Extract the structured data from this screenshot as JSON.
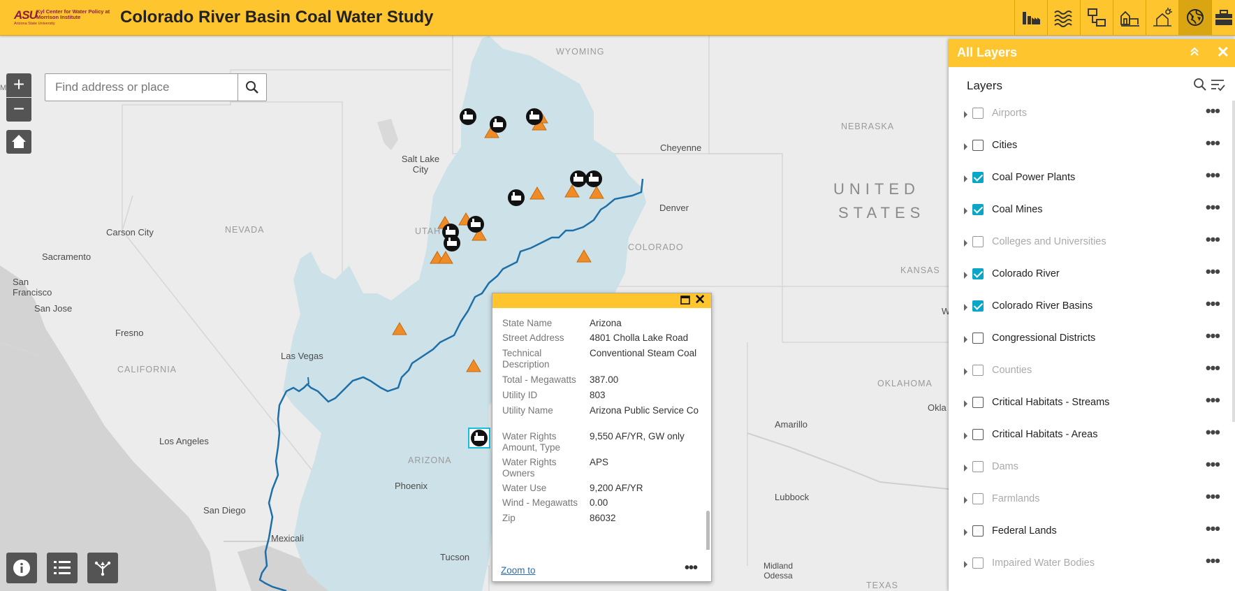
{
  "header": {
    "logo_asu": "ASU",
    "logo_center": "Kyl Center for Water Policy at Morrison Institute",
    "logo_university": "Arizona State University",
    "title": "Colorado River Basin Coal Water Study",
    "tools": [
      {
        "name": "coal-power-plant-icon",
        "active": false
      },
      {
        "name": "water-waves-icon",
        "active": false
      },
      {
        "name": "flow-diagram-icon",
        "active": false
      },
      {
        "name": "farm-icon",
        "active": false
      },
      {
        "name": "drought-icon",
        "active": false
      },
      {
        "name": "globe-layers-icon",
        "active": true
      },
      {
        "name": "toolbox-icon",
        "active": false
      }
    ]
  },
  "search": {
    "placeholder": "Find address or place"
  },
  "map_labels": {
    "states": [
      "WYOMING",
      "NEBRASKA",
      "NEVADA",
      "UTAH",
      "COLORADO",
      "KANSAS",
      "CALIFORNIA",
      "ARIZONA",
      "OKLAHOMA",
      "TEXAS"
    ],
    "country": [
      "UNITED",
      "STATES"
    ],
    "cities": [
      "Salt Lake City",
      "Cheyenne",
      "Denver",
      "Carson City",
      "Sacramento",
      "San Francisco",
      "San Jose",
      "Fresno",
      "Las Vegas",
      "Los Angeles",
      "San Diego",
      "Mexicali",
      "Phoenix",
      "Tucson",
      "Amarillo",
      "Lubbock",
      "Midland Odessa",
      "Okla",
      "W",
      "Medford"
    ]
  },
  "popup": {
    "fields": [
      {
        "key": "State Name",
        "value": "Arizona"
      },
      {
        "key": "Street Address",
        "value": "4801 Cholla Lake Road"
      },
      {
        "key": "Technical Description",
        "value": "Conventional Steam Coal"
      },
      {
        "key": "Total - Megawatts",
        "value": "387.00"
      },
      {
        "key": "Utility ID",
        "value": "803"
      },
      {
        "key": "Utility Name",
        "value": "Arizona Public Service Co"
      },
      {
        "key": "Water Rights Amount, Type",
        "value": "9,550 AF/YR, GW only"
      },
      {
        "key": "Water Rights Owners",
        "value": "APS"
      },
      {
        "key": "Water Use",
        "value": "9,200 AF/YR"
      },
      {
        "key": "Wind - Megawatts",
        "value": "0.00"
      },
      {
        "key": "Zip",
        "value": "86032"
      }
    ],
    "zoom_to": "Zoom to",
    "more": "•••"
  },
  "layers_panel": {
    "title": "All Layers",
    "heading": "Layers",
    "layers": [
      {
        "name": "Airports",
        "checked": false,
        "dim": true
      },
      {
        "name": "Cities",
        "checked": false,
        "dim": false
      },
      {
        "name": "Coal Power Plants",
        "checked": true,
        "dim": false
      },
      {
        "name": "Coal Mines",
        "checked": true,
        "dim": false
      },
      {
        "name": "Colleges and Universities",
        "checked": false,
        "dim": true
      },
      {
        "name": "Colorado River",
        "checked": true,
        "dim": false
      },
      {
        "name": "Colorado River Basins",
        "checked": true,
        "dim": false
      },
      {
        "name": "Congressional Districts",
        "checked": false,
        "dim": false
      },
      {
        "name": "Counties",
        "checked": false,
        "dim": true
      },
      {
        "name": "Critical Habitats - Streams",
        "checked": false,
        "dim": false
      },
      {
        "name": "Critical Habitats - Areas",
        "checked": false,
        "dim": false
      },
      {
        "name": "Dams",
        "checked": false,
        "dim": true
      },
      {
        "name": "Farmlands",
        "checked": false,
        "dim": true
      },
      {
        "name": "Federal Lands",
        "checked": false,
        "dim": false
      },
      {
        "name": "Impaired Water Bodies",
        "checked": false,
        "dim": true
      }
    ],
    "more": "•••"
  },
  "colors": {
    "accent": "#fec52e",
    "basin": "#cfe5eb",
    "river": "#1e6fa8",
    "mine": "#f08c28",
    "check": "#0aa6c7"
  }
}
